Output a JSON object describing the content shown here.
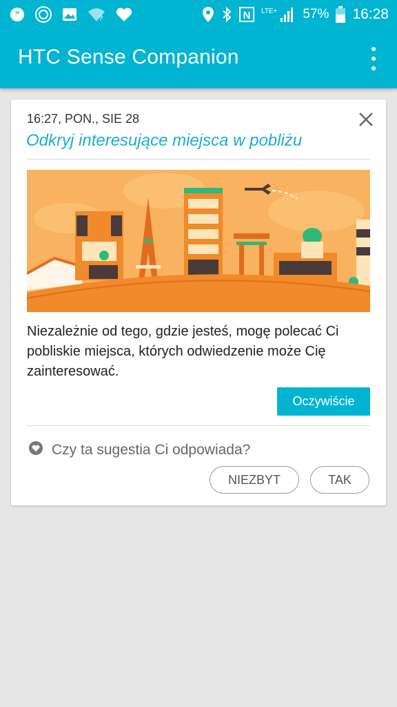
{
  "status_bar": {
    "icons_left": [
      "quote-icon",
      "smiley-icon",
      "image-icon",
      "wifi-question-icon",
      "heart-icon"
    ],
    "icons_right": [
      "location-icon",
      "bluetooth-icon",
      "nfc-icon",
      "lte-signal-icon",
      "battery-icon"
    ],
    "network_label": "LTE+",
    "battery_percent": "57%",
    "time": "16:28"
  },
  "app_bar": {
    "title": "HTC Sense Companion"
  },
  "card": {
    "timestamp": "16:27, PON., SIE 28",
    "headline": "Odkryj interesujące miejsca w pobliżu",
    "body": "Niezależnie od tego, gdzie jesteś, mogę polecać Ci pobliskie miejsca, których odwiedzenie może Cię zainteresować.",
    "primary_action": "Oczywiście",
    "feedback_question": "Czy ta sugestia Ci odpowiada?",
    "feedback_no": "NIEZBYT",
    "feedback_yes": "TAK"
  },
  "colors": {
    "accent": "#00b4d2",
    "headline": "#1aaed2",
    "illustration_orange": "#f08a2a",
    "background": "#e6e6e7"
  }
}
